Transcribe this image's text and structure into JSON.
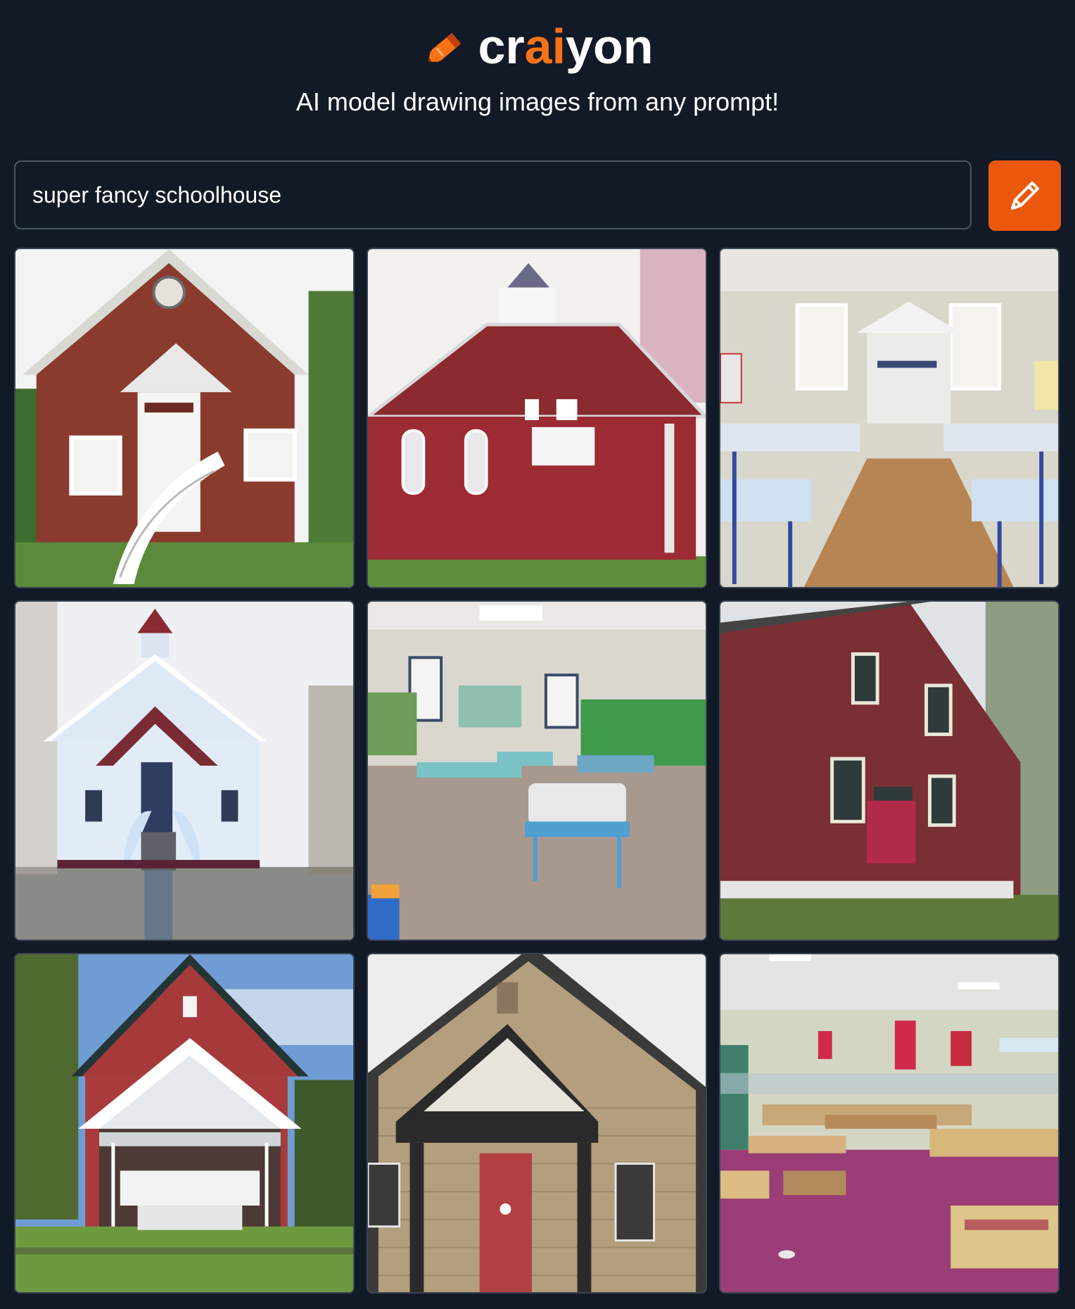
{
  "brand": {
    "name_prefix": "cr",
    "name_accent": "ai",
    "name_suffix": "yon",
    "logo_icon": "crayon-icon",
    "accent_color": "#f97316"
  },
  "tagline": "AI model drawing images from any prompt!",
  "search": {
    "value": "super fancy schoolhouse",
    "placeholder": "",
    "button_icon": "pencil-icon",
    "button_color": "#ea580c"
  },
  "results": [
    {
      "subject": "red brick schoolhouse with white curved staircase",
      "icon": "generated-image"
    },
    {
      "subject": "red clapboard schoolhouse with cupola",
      "icon": "generated-image"
    },
    {
      "subject": "classroom interior with desks and wooden floor",
      "icon": "generated-image"
    },
    {
      "subject": "white schoolhouse with red cupola and stairs",
      "icon": "generated-image"
    },
    {
      "subject": "classroom interior with blue tables and green board",
      "icon": "generated-image"
    },
    {
      "subject": "red brick two story schoolhouse with red door",
      "icon": "generated-image"
    },
    {
      "subject": "red schoolhouse with white gable porch",
      "icon": "generated-image"
    },
    {
      "subject": "tan clapboard schoolhouse with red door",
      "icon": "generated-image"
    },
    {
      "subject": "classroom interior with purple floor and desks",
      "icon": "generated-image"
    }
  ]
}
